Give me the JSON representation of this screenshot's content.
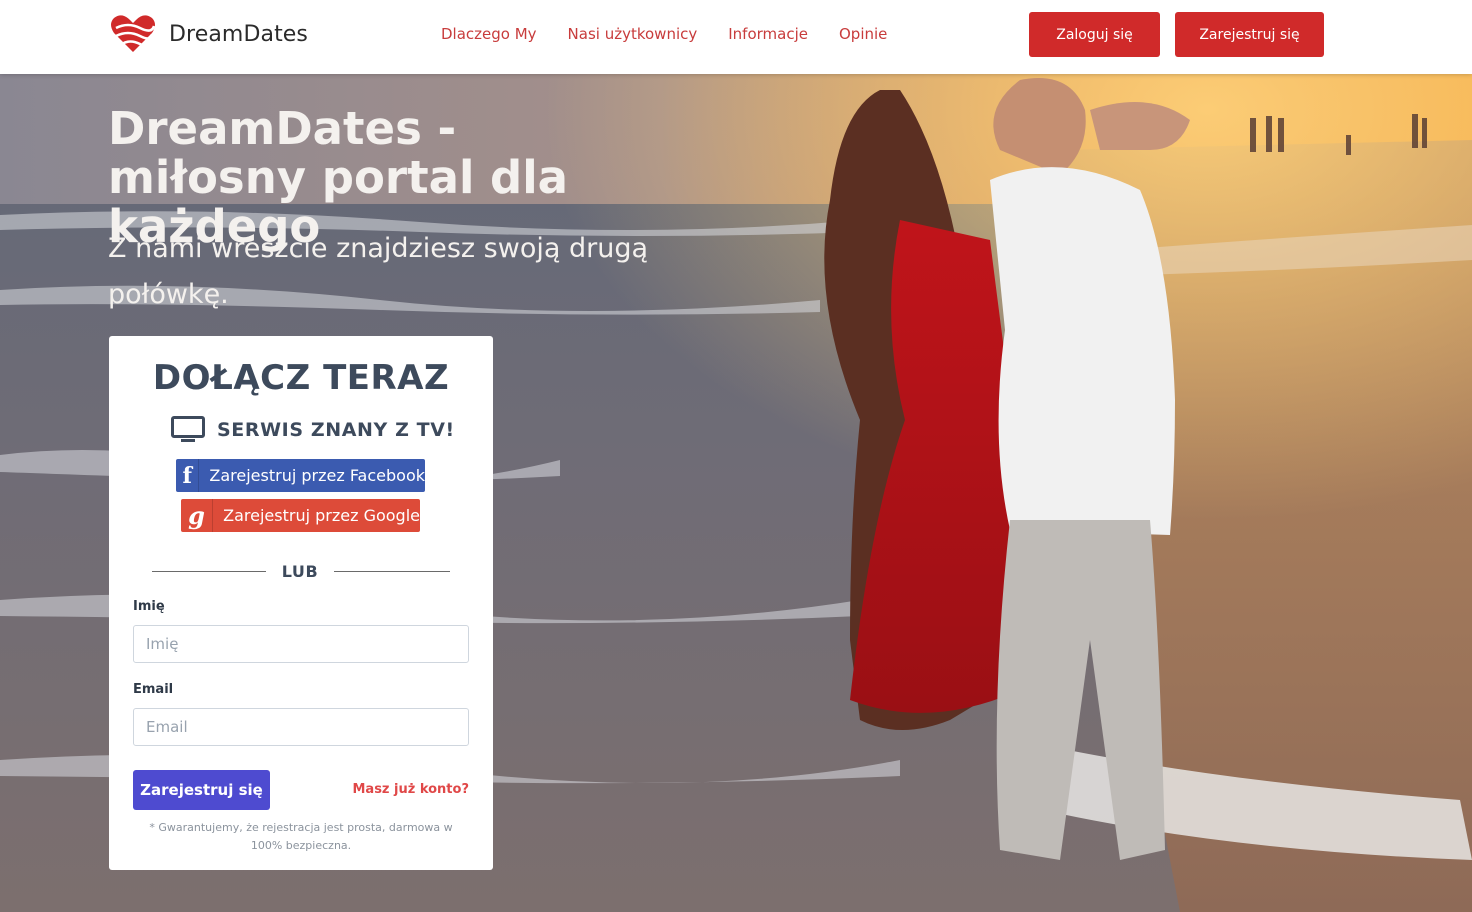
{
  "brand": {
    "name": "DreamDates"
  },
  "nav": {
    "items": [
      "Dlaczego My",
      "Nasi użytkownicy",
      "Informacje",
      "Opinie"
    ],
    "login_label": "Zaloguj się",
    "register_label": "Zarejestruj się"
  },
  "hero": {
    "headline": "DreamDates - miłosny portal dla każdego",
    "subline": "Z nami wreszcie znajdziesz swoją drugą połówkę."
  },
  "signup": {
    "title": "DOŁĄCZ TERAZ",
    "tv_label": "SERWIS ZNANY Z TV!",
    "tv_icon": "tv-icon",
    "facebook_label": "Zarejestruj przez Facebook",
    "google_label": "Zarejestruj przez Google",
    "divider_label": "LUB",
    "name_label": "Imię",
    "name_placeholder": "Imię",
    "email_label": "Email",
    "email_placeholder": "Email",
    "submit_label": "Zarejestruj się",
    "have_account_label": "Masz już konto?",
    "note": "* Gwarantujemy, że rejestracja jest prosta, darmowa w 100% bezpieczna."
  },
  "colors": {
    "brand_red": "#d02a2a",
    "nav_link": "#c83c3c",
    "facebook": "#3b5bb0",
    "google": "#dd4b39",
    "submit": "#4e4bd0",
    "text_dark": "#3d4a5c"
  }
}
